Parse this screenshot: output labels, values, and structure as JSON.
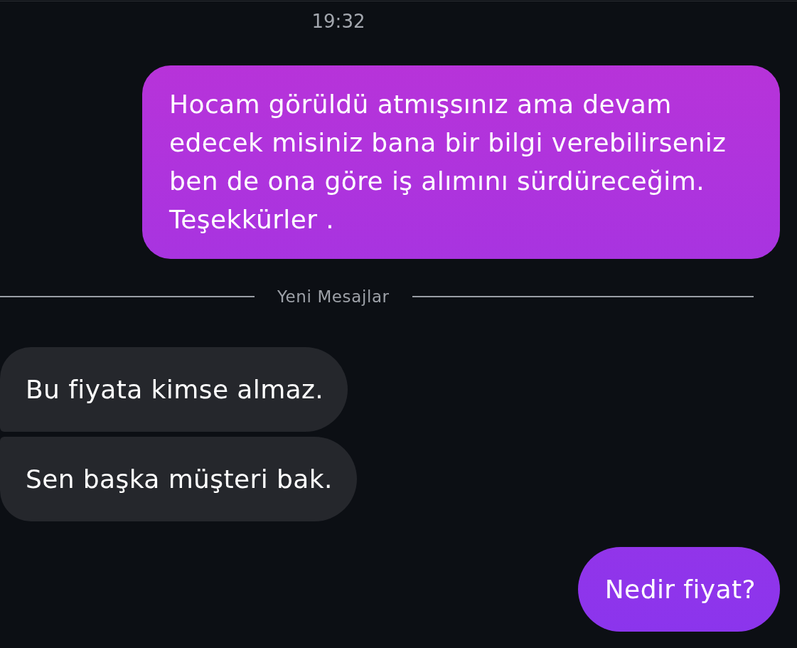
{
  "thread": [
    {
      "kind": "timestamp",
      "text": "19:32"
    },
    {
      "kind": "sent",
      "text": "Hocam görüldü atmışsınız ama devam edecek misiniz bana bir bilgi verebilirseniz ben de ona göre iş alımını sürdüreceğim. Teşekkürler ."
    },
    {
      "kind": "divider",
      "text": "Yeni Mesajlar"
    },
    {
      "kind": "received",
      "text": "Bu fiyata kimse almaz."
    },
    {
      "kind": "received",
      "text": "Sen başka müşteri bak."
    },
    {
      "kind": "sent",
      "text": "Nedir fiyat?"
    }
  ]
}
